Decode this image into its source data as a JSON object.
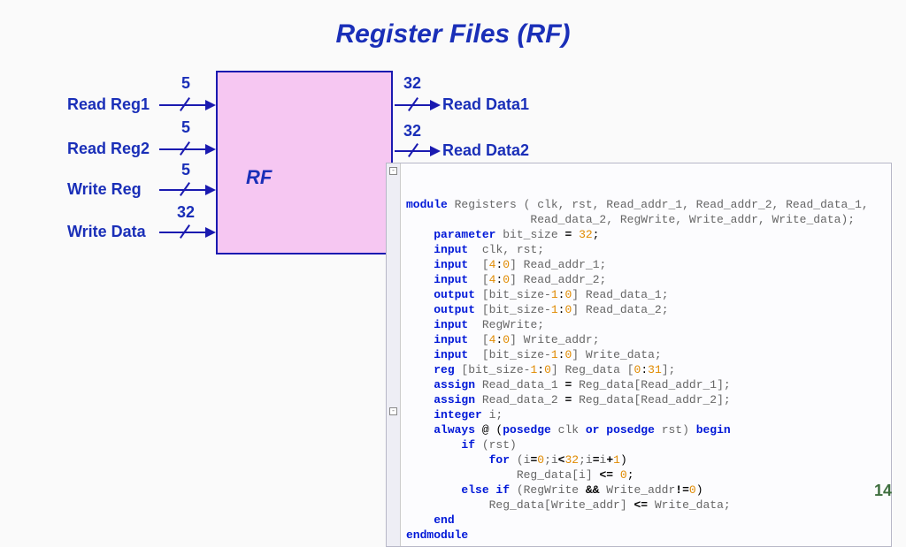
{
  "title": "Register Files (RF)",
  "rf_label": "RF",
  "inputs": [
    {
      "label": "Read Reg1",
      "width": "5"
    },
    {
      "label": "Read Reg2",
      "width": "5"
    },
    {
      "label": "Write Reg",
      "width": "5"
    },
    {
      "label": "Write Data",
      "width": "32"
    }
  ],
  "outputs": [
    {
      "label": "Read Data1",
      "width": "32"
    },
    {
      "label": "Read Data2",
      "width": "32"
    }
  ],
  "page_number": "14",
  "code": {
    "l1_kw": "module",
    "l1_name": "Registers",
    "l1_args": " ( clk, rst, Read_addr_1, Read_addr_2, Read_data_1,",
    "l2": "                  Read_data_2, RegWrite, Write_addr, Write_data);",
    "l3_kw": "parameter",
    "l3_rest": " bit_size ",
    "l3_eq": "=",
    "l3_num": " 32",
    "l3_end": ";",
    "l4_kw": "input",
    "l4_rest": "  clk, rst;",
    "l5_kw": "input",
    "l5_rest": "  [",
    "l5_n1": "4",
    "l5_c": ":",
    "l5_n2": "0",
    "l5_r2": "] Read_addr_1;",
    "l6_kw": "input",
    "l6_rest": "  [",
    "l6_n1": "4",
    "l6_c": ":",
    "l6_n2": "0",
    "l6_r2": "] Read_addr_2;",
    "l7_kw": "output",
    "l7_rest": " [bit_size-",
    "l7_n1": "1",
    "l7_c": ":",
    "l7_n2": "0",
    "l7_r2": "] Read_data_1;",
    "l8_kw": "output",
    "l8_rest": " [bit_size-",
    "l8_n1": "1",
    "l8_c": ":",
    "l8_n2": "0",
    "l8_r2": "] Read_data_2;",
    "l9_kw": "input",
    "l9_rest": "  RegWrite;",
    "l10_kw": "input",
    "l10_rest": "  [",
    "l10_n1": "4",
    "l10_c": ":",
    "l10_n2": "0",
    "l10_r2": "] Write_addr;",
    "l11_kw": "input",
    "l11_rest": "  [bit_size-",
    "l11_n1": "1",
    "l11_c": ":",
    "l11_n2": "0",
    "l11_r2": "] Write_data;",
    "l12_kw": "reg",
    "l12_rest": " [bit_size-",
    "l12_n1": "1",
    "l12_c": ":",
    "l12_n2": "0",
    "l12_r2": "] Reg_data [",
    "l12_n3": "0",
    "l12_c2": ":",
    "l12_n4": "31",
    "l12_r3": "];",
    "l13_kw": "assign",
    "l13_rest": " Read_data_1 ",
    "l13_eq": "=",
    "l13_r2": " Reg_data[Read_addr_1];",
    "l14_kw": "assign",
    "l14_rest": " Read_data_2 ",
    "l14_eq": "=",
    "l14_r2": " Reg_data[Read_addr_2];",
    "l15_kw": "integer",
    "l15_rest": " i;",
    "l16_kw": "always",
    "l16_at": " @ (",
    "l16_kw2": "posedge",
    "l16_m": " clk ",
    "l16_kw3": "or posedge",
    "l16_m2": " rst) ",
    "l16_kw4": "begin",
    "l17_kw": "if",
    "l17_rest": " (rst)",
    "l18_kw": "for",
    "l18_rest": " (i",
    "l18_eq": "=",
    "l18_n1": "0",
    "l18_m": ";i",
    "l18_lt": "<",
    "l18_n2": "32",
    "l18_m2": ";i",
    "l18_eq2": "=",
    "l18_m3": "i",
    "l18_pl": "+",
    "l18_n3": "1",
    "l18_r": ")",
    "l19_rest": "Reg_data[i] ",
    "l19_op": "<=",
    "l19_sp": " ",
    "l19_n": "0",
    "l19_end": ";",
    "l20_kw": "else if",
    "l20_rest": " (RegWrite ",
    "l20_op": "&&",
    "l20_m": " Write_addr",
    "l20_ne": "!=",
    "l20_n": "0",
    "l20_r": ")",
    "l21_rest": "Reg_data[Write_addr] ",
    "l21_op": "<=",
    "l21_m": " Write_data;",
    "l22_kw": "end",
    "l23_kw": "endmodule"
  }
}
